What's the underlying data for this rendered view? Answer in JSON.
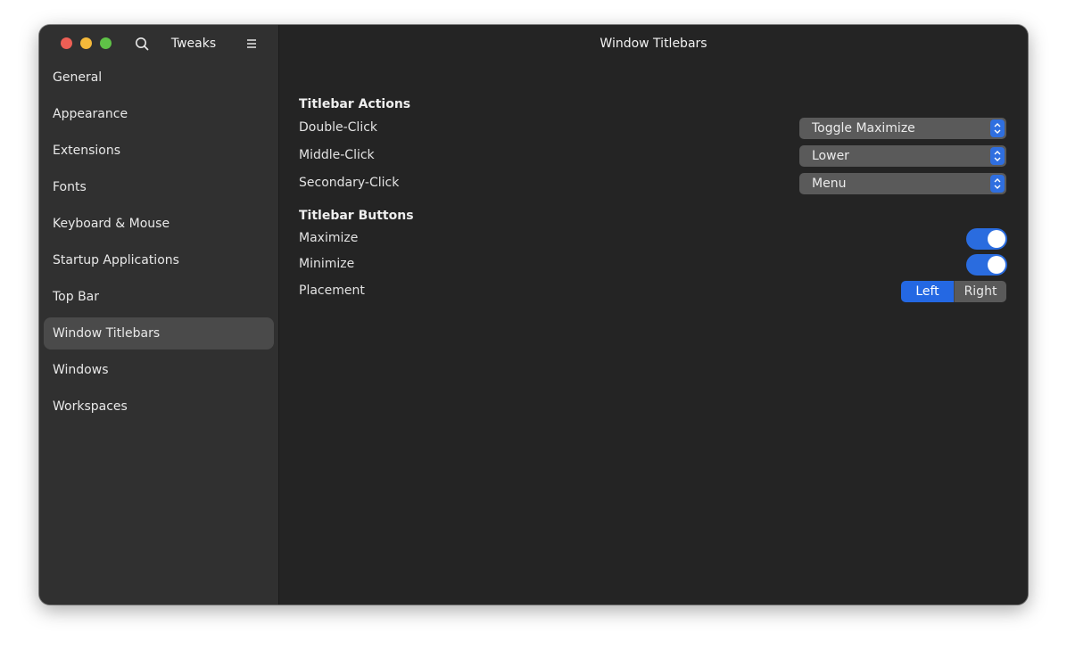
{
  "app": {
    "sidebar_title": "Tweaks",
    "page_title": "Window Titlebars"
  },
  "sidebar": {
    "items": [
      {
        "label": "General"
      },
      {
        "label": "Appearance"
      },
      {
        "label": "Extensions"
      },
      {
        "label": "Fonts"
      },
      {
        "label": "Keyboard & Mouse"
      },
      {
        "label": "Startup Applications"
      },
      {
        "label": "Top Bar"
      },
      {
        "label": "Window Titlebars",
        "active": true
      },
      {
        "label": "Windows"
      },
      {
        "label": "Workspaces"
      }
    ]
  },
  "titlebar_actions": {
    "heading": "Titlebar Actions",
    "double_click": {
      "label": "Double-Click",
      "value": "Toggle Maximize"
    },
    "middle_click": {
      "label": "Middle-Click",
      "value": "Lower"
    },
    "secondary_click": {
      "label": "Secondary-Click",
      "value": "Menu"
    }
  },
  "titlebar_buttons": {
    "heading": "Titlebar Buttons",
    "maximize": {
      "label": "Maximize",
      "enabled": true
    },
    "minimize": {
      "label": "Minimize",
      "enabled": true
    },
    "placement": {
      "label": "Placement",
      "options": [
        "Left",
        "Right"
      ],
      "selected": "Left"
    }
  },
  "icons": {
    "search": "search-icon",
    "menu": "hamburger-menu-icon",
    "combo": "up-down-arrows-icon"
  },
  "colors": {
    "accent": "#2a6cdf",
    "close": "#ed5f55",
    "minimize": "#f4b93a",
    "maximize": "#5fc247"
  }
}
